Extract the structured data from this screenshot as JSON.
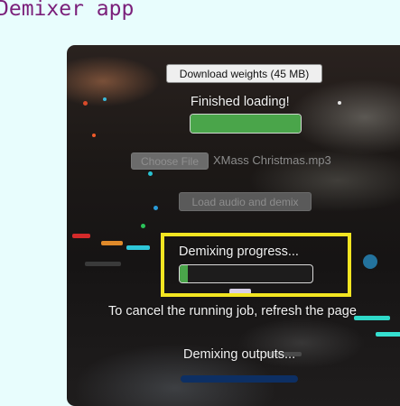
{
  "app": {
    "title": "Demixer app"
  },
  "controls": {
    "download_button": "Download weights (45 MB)",
    "loading_status": "Finished loading!",
    "loading_progress": 1.0,
    "choose_file_button": "Choose File",
    "selected_file": "XMass Christmas.mp3",
    "load_demix_button": "Load audio and demix"
  },
  "demix": {
    "progress_label": "Demixing progress...",
    "progress": 0.06,
    "cancel_hint": "To cancel the running job, refresh the page",
    "outputs_label": "Demixing outputs..."
  },
  "colors": {
    "title": "#7a1f7a",
    "progress_fill": "#4aa54a",
    "highlight": "#f2e521",
    "page_bg": "#e8fdfd"
  }
}
